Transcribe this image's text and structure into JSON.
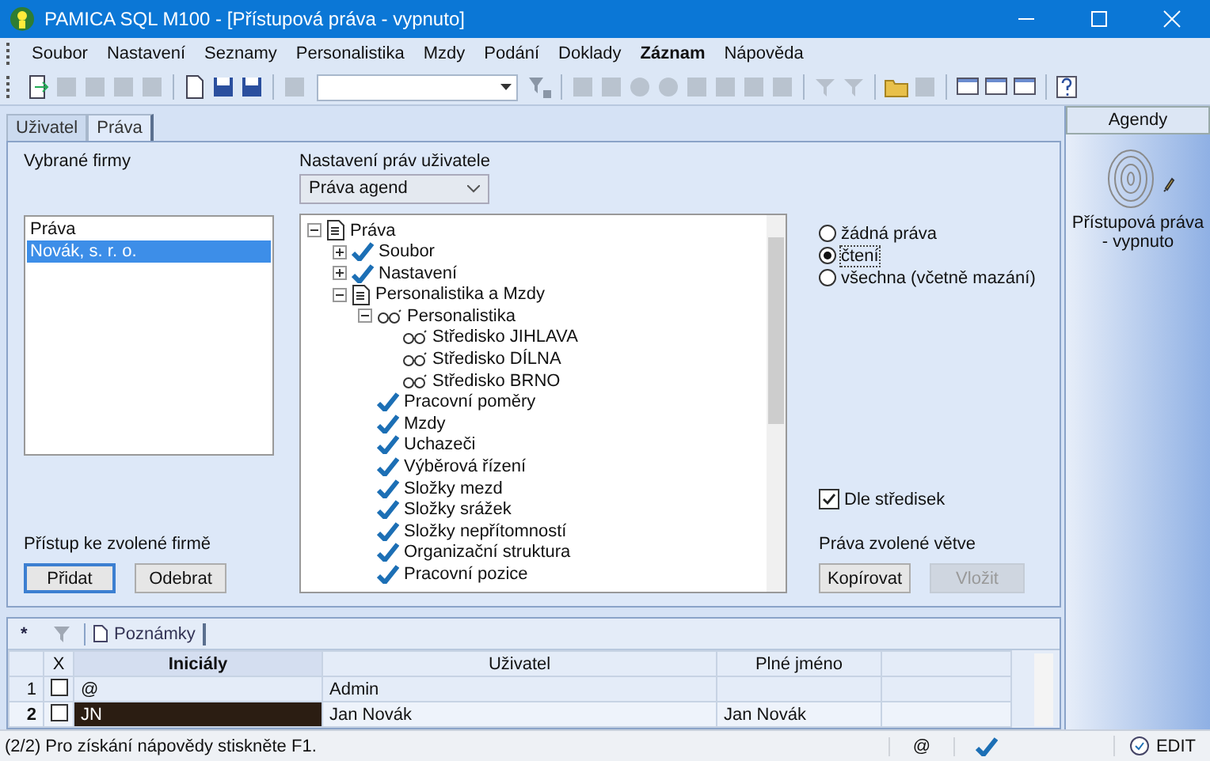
{
  "window": {
    "title": "PAMICA SQL M100 - [Přístupová práva - vypnuto]"
  },
  "menu": [
    {
      "label": "Soubor",
      "emphasized": false
    },
    {
      "label": "Nastavení",
      "emphasized": false
    },
    {
      "label": "Seznamy",
      "emphasized": false
    },
    {
      "label": "Personalistika",
      "emphasized": false
    },
    {
      "label": "Mzdy",
      "emphasized": false
    },
    {
      "label": "Podání",
      "emphasized": false
    },
    {
      "label": "Doklady",
      "emphasized": false
    },
    {
      "label": "Záznam",
      "emphasized": true
    },
    {
      "label": "Nápověda",
      "emphasized": false
    }
  ],
  "tabs": [
    {
      "label": "Uživatel",
      "selected": false
    },
    {
      "label": "Práva",
      "selected": true
    }
  ],
  "firms": {
    "label": "Vybrané firmy",
    "items": [
      {
        "label": "Práva",
        "selected": false
      },
      {
        "label": "Novák, s. r. o.",
        "selected": true
      }
    ],
    "access_label": "Přístup ke zvolené firmě",
    "buttons": [
      {
        "label": "Přidat",
        "disabled": false,
        "default": true
      },
      {
        "label": "Odebrat",
        "disabled": false,
        "default": false
      }
    ]
  },
  "rights": {
    "label": "Nastavení práv uživatele",
    "dropdown": "Práva agend",
    "tree": [
      {
        "label": "Práva",
        "kind": "doc",
        "expanded": true,
        "children": [
          {
            "label": "Soubor",
            "kind": "check",
            "expanded": false
          },
          {
            "label": "Nastavení",
            "kind": "check",
            "expanded": false
          },
          {
            "label": "Personalistika a Mzdy",
            "kind": "doc",
            "expanded": true,
            "children": [
              {
                "label": "Personalistika",
                "kind": "read",
                "expanded": true,
                "children": [
                  {
                    "label": "Středisko JIHLAVA",
                    "kind": "read"
                  },
                  {
                    "label": "Středisko DÍLNA",
                    "kind": "read"
                  },
                  {
                    "label": "Středisko BRNO",
                    "kind": "read"
                  }
                ]
              },
              {
                "label": "Pracovní poměry",
                "kind": "check"
              },
              {
                "label": "Mzdy",
                "kind": "check"
              },
              {
                "label": "Uchazeči",
                "kind": "check"
              },
              {
                "label": "Výběrová řízení",
                "kind": "check"
              },
              {
                "label": "Složky mezd",
                "kind": "check"
              },
              {
                "label": "Složky srážek",
                "kind": "check"
              },
              {
                "label": "Složky nepřítomností",
                "kind": "check"
              },
              {
                "label": "Organizační struktura",
                "kind": "check"
              },
              {
                "label": "Pracovní pozice",
                "kind": "check"
              }
            ]
          }
        ]
      }
    ],
    "options": [
      {
        "label": "žádná práva",
        "selected": false
      },
      {
        "label": "čtení",
        "selected": true
      },
      {
        "label": "všechna (včetně mazání)",
        "selected": false
      }
    ],
    "by_centers": {
      "label": "Dle středisek",
      "checked": true
    },
    "branch_label": "Práva zvolené větve",
    "branch_buttons": [
      {
        "label": "Kopírovat",
        "disabled": false
      },
      {
        "label": "Vložit",
        "disabled": true
      }
    ]
  },
  "agendas": {
    "title": "Agendy",
    "item": "Přístupová práva - vypnuto"
  },
  "grid": {
    "star": "*",
    "tab": "Poznámky",
    "columns": [
      "X",
      "Iniciály",
      "Uživatel",
      "Plné jméno"
    ],
    "rows": [
      {
        "number": "1",
        "checked": false,
        "initials": "@",
        "user": "Admin",
        "full_name": "",
        "selected": false
      },
      {
        "number": "2",
        "checked": false,
        "initials": "JN",
        "user": "Jan Novák",
        "full_name": "Jan Novák",
        "selected": true
      }
    ]
  },
  "status_bar": {
    "text": "(2/2) Pro získání nápovědy stiskněte F1.",
    "symbol": "@",
    "mode": "EDIT"
  }
}
